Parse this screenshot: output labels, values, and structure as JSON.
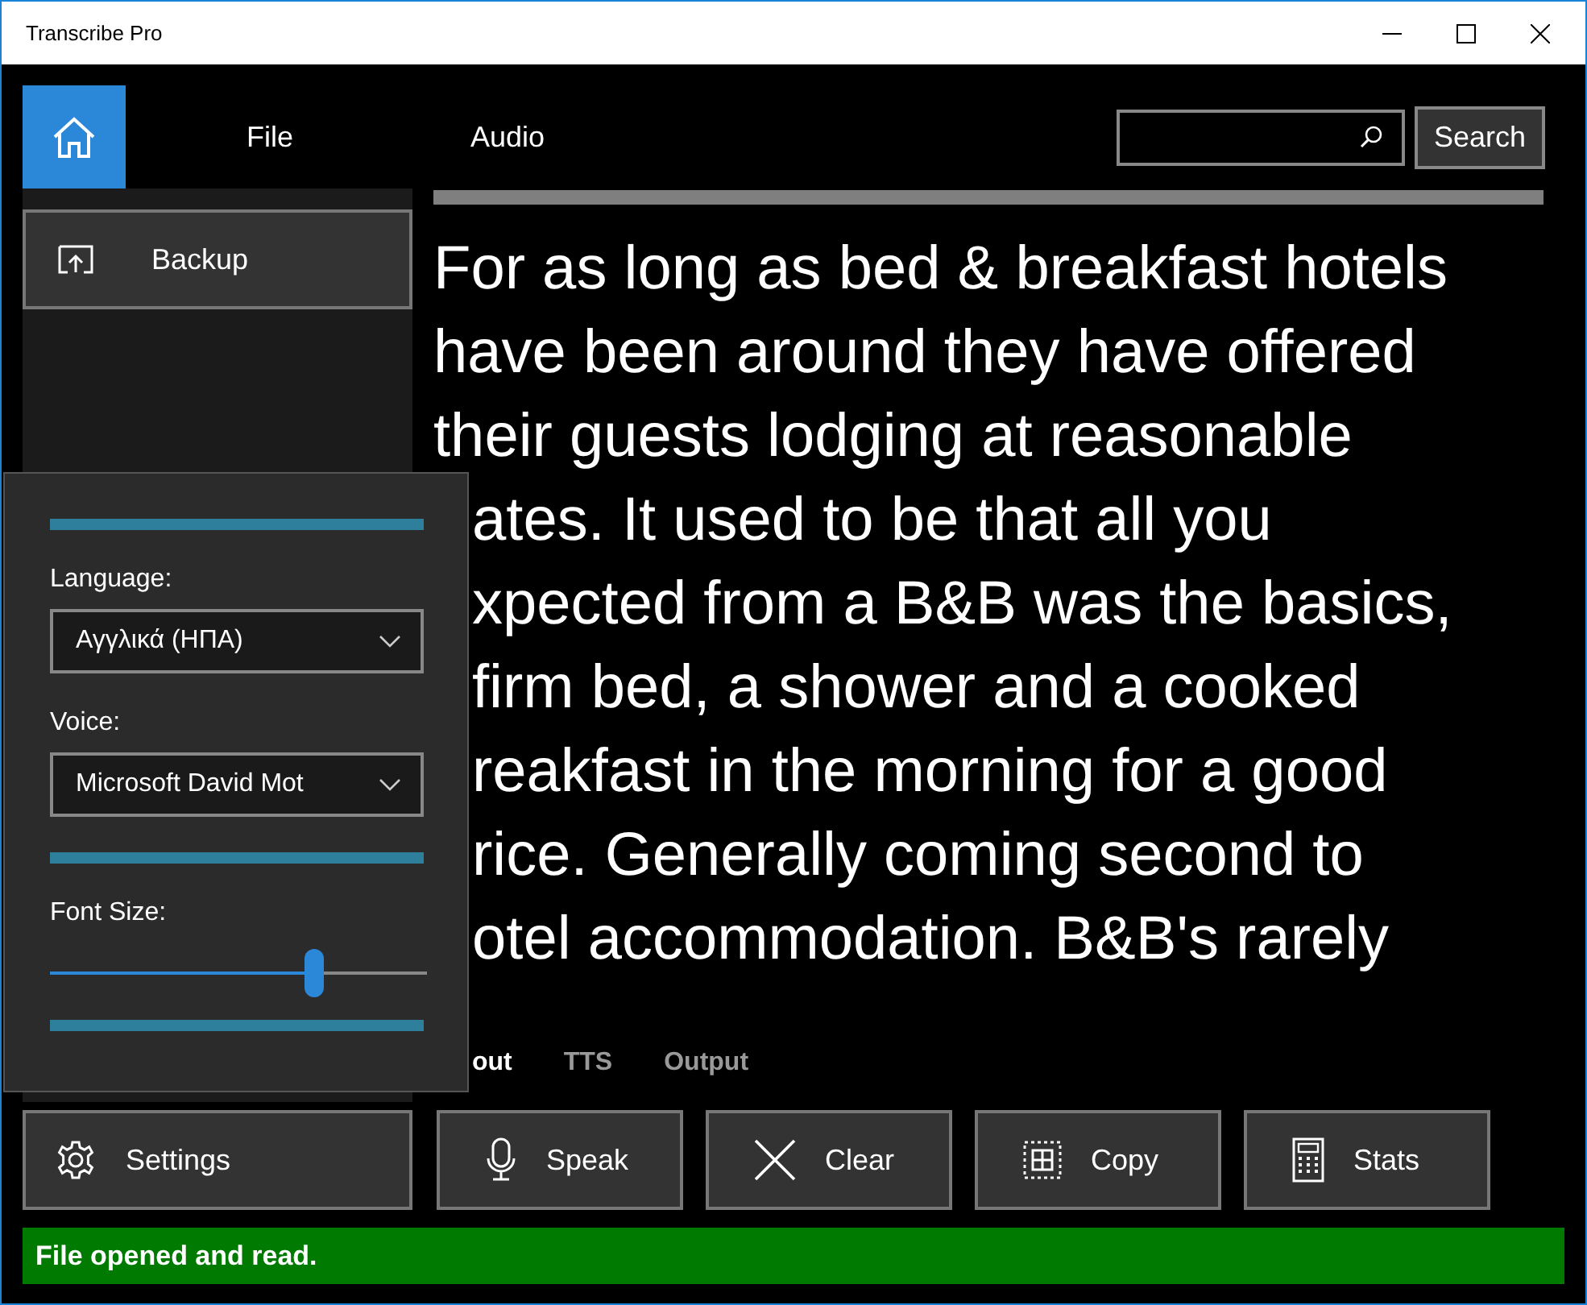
{
  "window": {
    "title": "Transcribe Pro"
  },
  "nav": {
    "items": [
      {
        "label": "File"
      },
      {
        "label": "Audio"
      }
    ],
    "search_button": "Search"
  },
  "sidebar": {
    "items": [
      {
        "label": "Backup"
      }
    ]
  },
  "text_lines": [
    "For as long as bed & breakfast hotels",
    "have been around they have offered",
    "their guests lodging at reasonable",
    "ates. It used to be that all you",
    "xpected from a B&B was the basics,",
    "firm bed, a shower and a cooked",
    "reakfast in the morning for a good",
    "rice. Generally coming second to",
    "otel accommodation. B&B's rarely"
  ],
  "tabs": [
    {
      "label": "out",
      "selected": true
    },
    {
      "label": "TTS",
      "selected": false
    },
    {
      "label": "Output",
      "selected": false
    }
  ],
  "buttons": [
    {
      "kind": "settings",
      "label": "Settings"
    },
    {
      "kind": "speak",
      "label": "Speak"
    },
    {
      "kind": "clear",
      "label": "Clear"
    },
    {
      "kind": "copy",
      "label": "Copy"
    },
    {
      "kind": "stats",
      "label": "Stats"
    }
  ],
  "settings_panel": {
    "language_label": "Language:",
    "language": "Αγγλικά (ΗΠΑ)",
    "voice_label": "Voice:",
    "voice": "Microsoft David Mot",
    "font_size_label": "Font Size:",
    "font_size": {
      "level": 0.7
    }
  },
  "status_bar": "File opened and read."
}
